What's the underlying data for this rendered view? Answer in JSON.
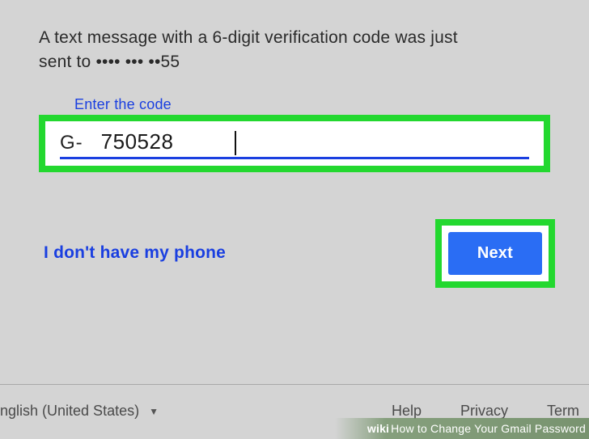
{
  "instruction": {
    "line1": "A text message with a 6-digit verification code was just",
    "line2": "sent to •••• ••• ••55"
  },
  "field": {
    "label": "Enter the code",
    "prefix": "G-",
    "value": "750528"
  },
  "actions": {
    "no_phone_label": "I don't have my phone",
    "next_label": "Next"
  },
  "footer": {
    "language": "nglish (United States)",
    "help": "Help",
    "privacy": "Privacy",
    "terms": "Term"
  },
  "watermark": {
    "prefix": "wiki",
    "text": "How to Change Your Gmail Password"
  }
}
